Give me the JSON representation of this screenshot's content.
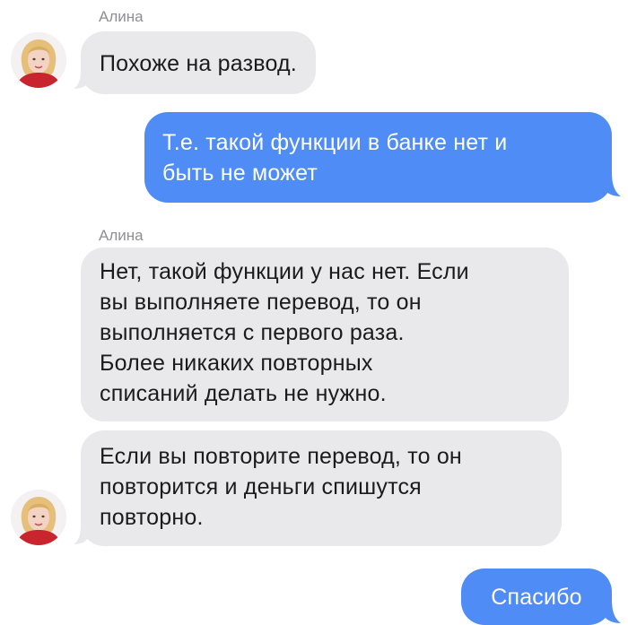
{
  "chat": {
    "messages": [
      {
        "sender": "Алина",
        "direction": "incoming",
        "text": "Похоже на развод."
      },
      {
        "direction": "outgoing",
        "text": "Т.е. такой функции в банке нет и\nбыть не может"
      },
      {
        "sender": "Алина",
        "direction": "incoming",
        "text": "Нет, такой функции у нас нет. Если\nвы выполняете перевод, то он\nвыполняется с первого раза.\nБолее никаких повторных\nсписаний делать не нужно."
      },
      {
        "direction": "incoming",
        "text": "Если вы повторите перевод, то он\nповторится и деньги спишутся\nповторно."
      },
      {
        "direction": "outgoing",
        "text": "Спасибо"
      }
    ]
  },
  "colors": {
    "incoming_bubble": "#e9e9eb",
    "outgoing_bubble": "#4f8cf5",
    "sender_name": "#8e8e93"
  },
  "icons": {
    "avatar": "avatar-photo-icon"
  }
}
